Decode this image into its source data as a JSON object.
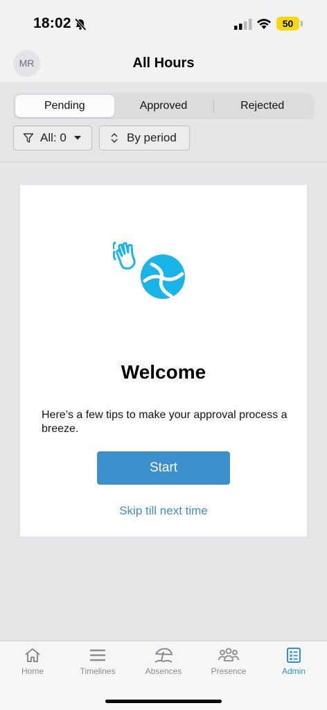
{
  "status_bar": {
    "time": "18:02",
    "battery": "50"
  },
  "header": {
    "avatar_initials": "MR",
    "title": "All Hours"
  },
  "tabs": {
    "pending": "Pending",
    "approved": "Approved",
    "rejected": "Rejected"
  },
  "filters": {
    "all_label": "All: 0",
    "period_label": "By period"
  },
  "card": {
    "title": "Welcome",
    "text": "Here’s a few tips to make your approval process a breeze.",
    "start_label": "Start",
    "skip_label": "Skip till next time"
  },
  "nav": [
    {
      "label": "Home",
      "icon": "home-icon"
    },
    {
      "label": "Timelines",
      "icon": "timelines-icon"
    },
    {
      "label": "Absences",
      "icon": "beach-umbrella-icon"
    },
    {
      "label": "Presence",
      "icon": "people-icon"
    },
    {
      "label": "Admin",
      "icon": "admin-list-icon"
    }
  ],
  "colors": {
    "accent": "#3b8fca",
    "battery": "#f5d90a",
    "illustration": "#19b4e8"
  }
}
